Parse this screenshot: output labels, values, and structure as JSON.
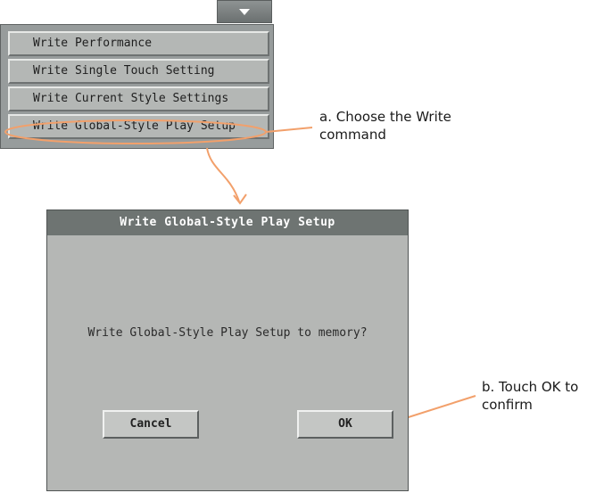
{
  "menu": {
    "items": [
      {
        "label": "Write Performance"
      },
      {
        "label": "Write Single Touch Setting"
      },
      {
        "label": "Write Current Style Settings"
      },
      {
        "label": "Write Global-Style Play Setup"
      }
    ],
    "dropdown_icon": "triangle-down-icon"
  },
  "annotations": {
    "step_a_line1": "a. Choose the Write",
    "step_a_line2": "command",
    "step_b_line1": "b. Touch OK to",
    "step_b_line2": "confirm",
    "highlight_color": "#f2a06b"
  },
  "dialog": {
    "title": "Write Global-Style Play Setup",
    "message": "Write Global-Style Play Setup to memory?",
    "cancel_label": "Cancel",
    "ok_label": "OK"
  },
  "colors": {
    "title_bar": "#6e7472",
    "panel": "#b5b7b5",
    "menu_bg": "#979c9c"
  }
}
